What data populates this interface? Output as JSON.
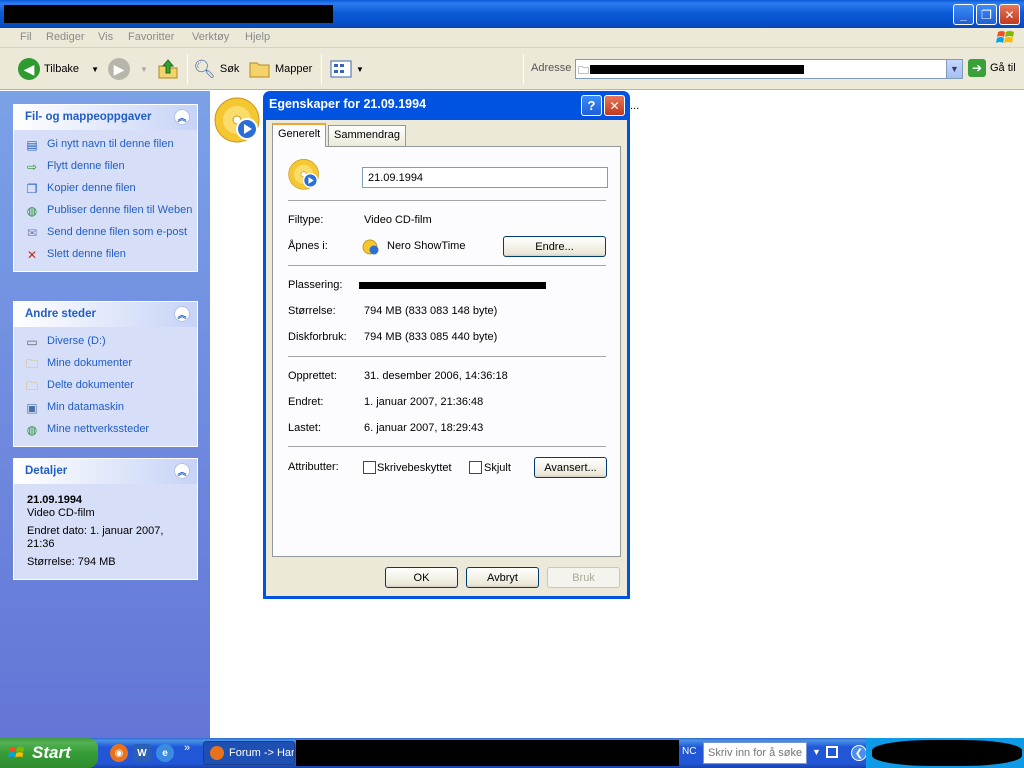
{
  "menubar": {
    "items": [
      "Fil",
      "Rediger",
      "Vis",
      "Favoritter",
      "Verktøy",
      "Hjelp"
    ]
  },
  "toolbar": {
    "back_label": "Tilbake",
    "search_label": "Søk",
    "folders_label": "Mapper",
    "address_label": "Adresse",
    "go_label": "Gå til"
  },
  "tasks_panel": {
    "title": "Fil- og mappeoppgaver",
    "items": [
      {
        "label": "Gi nytt navn til denne filen",
        "icon": "rename-icon"
      },
      {
        "label": "Flytt denne filen",
        "icon": "move-icon"
      },
      {
        "label": "Kopier denne filen",
        "icon": "copy-icon"
      },
      {
        "label": "Publiser denne filen til Weben",
        "icon": "globe-icon"
      },
      {
        "label": "Send denne filen som e-post",
        "icon": "email-icon"
      },
      {
        "label": "Slett denne filen",
        "icon": "delete-icon"
      }
    ]
  },
  "places_panel": {
    "title": "Andre steder",
    "items": [
      {
        "label": "Diverse (D:)",
        "icon": "drive-icon"
      },
      {
        "label": "Mine dokumenter",
        "icon": "folder-icon"
      },
      {
        "label": "Delte dokumenter",
        "icon": "folder-icon"
      },
      {
        "label": "Min datamaskin",
        "icon": "computer-icon"
      },
      {
        "label": "Mine nettverkssteder",
        "icon": "network-icon"
      }
    ]
  },
  "details_panel": {
    "title": "Detaljer",
    "file_name": "21.09.1994",
    "file_type": "Video CD-film",
    "modified": "Endret dato: 1. januar 2007, 21:36",
    "size": "Størrelse: 794 MB"
  },
  "main": {
    "ellipsis": "..."
  },
  "dialog": {
    "title": "Egenskaper for 21.09.1994",
    "tabs": [
      "Generelt",
      "Sammendrag"
    ],
    "file_name": "21.09.1994",
    "labels": {
      "filetype": "Filtype:",
      "opens_with": "Åpnes i:",
      "location": "Plassering:",
      "size": "Størrelse:",
      "size_on_disk": "Diskforbruk:",
      "created": "Opprettet:",
      "modified": "Endret:",
      "accessed": "Lastet:",
      "attributes": "Attributter:"
    },
    "values": {
      "filetype": "Video CD-film",
      "opens_with": "Nero ShowTime",
      "size": "794 MB (833 083 148 byte)",
      "size_on_disk": "794 MB (833 085 440 byte)",
      "created": "31. desember 2006, 14:36:18",
      "modified": "1. januar 2007, 21:36:48",
      "accessed": "6. januar 2007, 18:29:43"
    },
    "change_button": "Endre...",
    "readonly_label": "Skrivebeskyttet",
    "hidden_label": "Skjult",
    "advanced_button": "Avansert...",
    "ok_button": "OK",
    "cancel_button": "Avbryt",
    "apply_button": "Bruk"
  },
  "taskbar": {
    "start_label": "Start",
    "task_label": "Forum -> Har",
    "language": "NC",
    "search_placeholder": "Skriv inn for å søke"
  }
}
